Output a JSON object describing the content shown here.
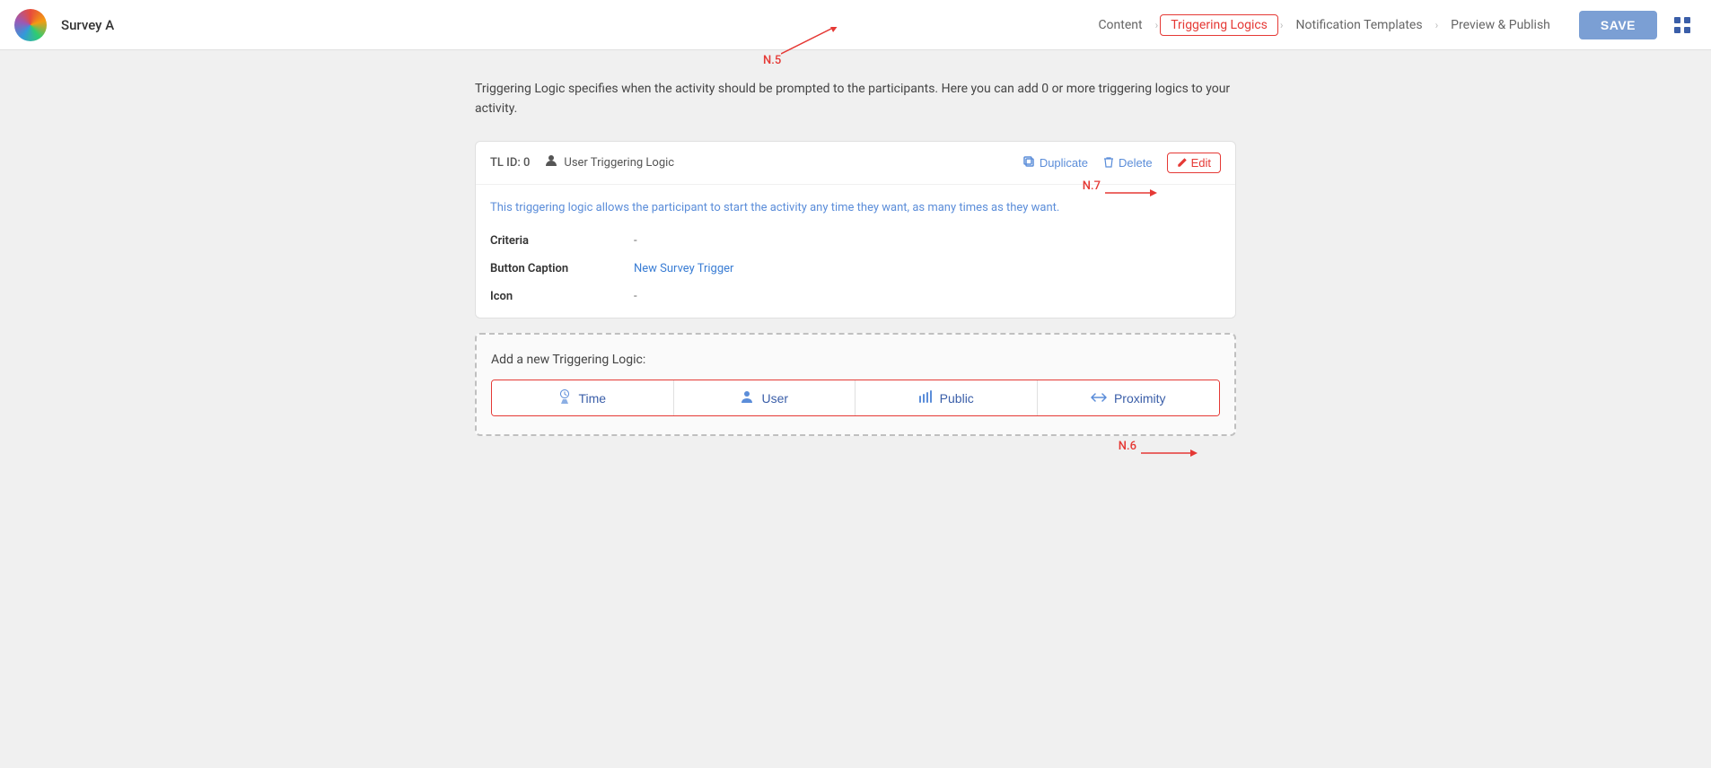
{
  "header": {
    "logo_alt": "App Logo",
    "survey_title": "Survey A",
    "nav_steps": [
      {
        "label": "Content",
        "active": false
      },
      {
        "label": "Triggering Logics",
        "active": true
      },
      {
        "label": "Notification Templates",
        "active": false
      },
      {
        "label": "Preview & Publish",
        "active": false
      }
    ],
    "save_label": "SAVE"
  },
  "description": "Triggering Logic specifies when the activity should be prompted to the participants. Here you can add 0 or more triggering logics to your activity.",
  "triggering_logic": {
    "id_label": "TL ID: 0",
    "type_icon": "👤",
    "type_label": "User Triggering Logic",
    "actions": {
      "duplicate": "Duplicate",
      "delete": "Delete",
      "edit": "Edit"
    },
    "body_description": "This triggering logic allows the participant to start the activity any time they want, as many times as they want.",
    "fields": [
      {
        "label": "Criteria",
        "value": "-",
        "style": "plain"
      },
      {
        "label": "Button Caption",
        "value": "New Survey Trigger",
        "style": "link"
      },
      {
        "label": "Icon",
        "value": "-",
        "style": "plain"
      }
    ]
  },
  "add_section": {
    "title": "Add a new Triggering Logic:",
    "options": [
      {
        "icon": "⏳",
        "label": "Time"
      },
      {
        "icon": "👤",
        "label": "User"
      },
      {
        "icon": "📊",
        "label": "Public"
      },
      {
        "icon": "↔",
        "label": "Proximity"
      }
    ]
  },
  "annotations": {
    "n5": "N.5",
    "n6": "N.6",
    "n7": "N.7"
  }
}
